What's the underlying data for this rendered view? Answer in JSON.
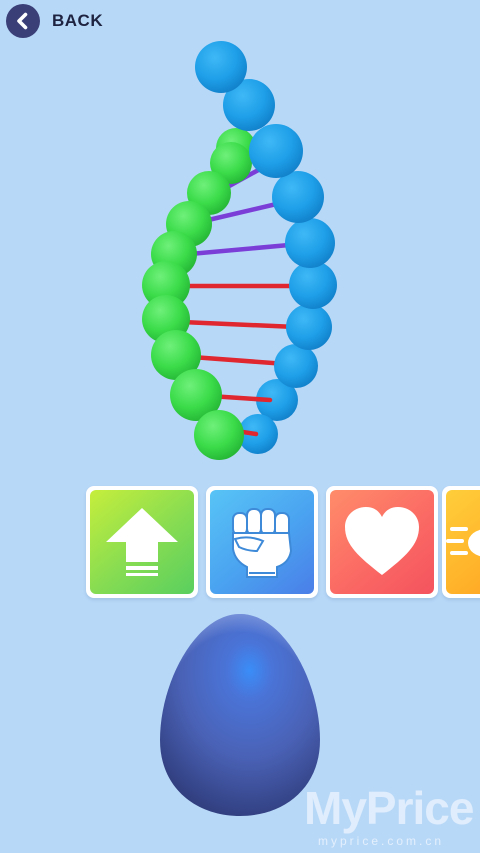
{
  "header": {
    "back_label": "BACK"
  },
  "dna": {
    "left_strand_color": "#3bdc4a",
    "right_strand_color": "#1e9fe8",
    "rung_colors": [
      "#7b3fd8",
      "#e0262e"
    ]
  },
  "abilities": [
    {
      "name": "upgrade",
      "icon": "up-arrow-icon",
      "color": "#86dc52"
    },
    {
      "name": "strength",
      "icon": "fist-icon",
      "color": "#4aa2f0"
    },
    {
      "name": "health",
      "icon": "heart-icon",
      "color": "#fb6a64"
    },
    {
      "name": "speed",
      "icon": "speed-icon",
      "color": "#ffb029"
    }
  ],
  "egg": {
    "color": "#4a62b6"
  },
  "watermark": {
    "title": "MyPrice",
    "subtitle": "myprice.com.cn"
  }
}
